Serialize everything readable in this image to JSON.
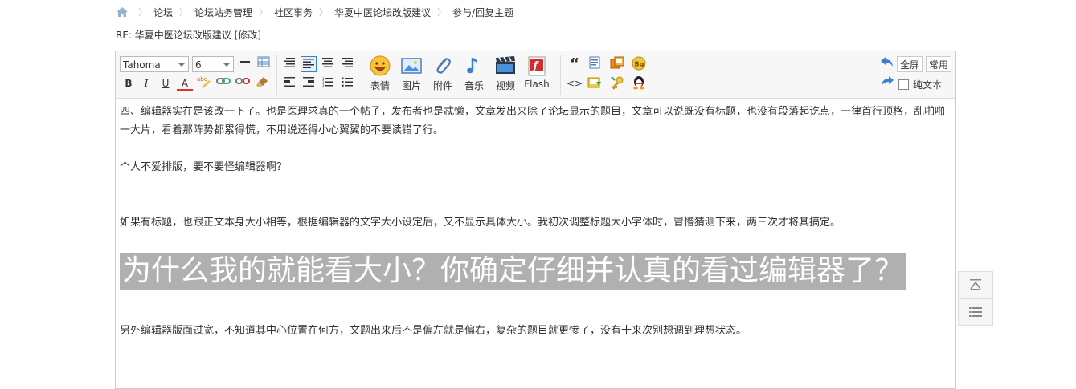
{
  "breadcrumb": {
    "items": [
      "论坛",
      "论坛站务管理",
      "社区事务",
      "华夏中医论坛改版建议",
      "参与/回复主题"
    ]
  },
  "subtitle": "RE: 华夏中医论坛改版建议 [修改]",
  "toolbar": {
    "font_family": "Tahoma",
    "font_size": "6",
    "big_buttons": [
      "表情",
      "图片",
      "附件",
      "音乐",
      "视频",
      "Flash"
    ],
    "fullscreen": "全屏",
    "common": "常用",
    "plain_text": "纯文本",
    "bold": "B",
    "italic": "I",
    "underline": "U",
    "font_color": "A",
    "quote": "“",
    "code": "<>"
  },
  "content": {
    "p1": "四、编辑器实在是该改一下了。也是医理求真的一个帖子，发布者也是忒懒，文章发出来除了论坛显示的题目，文章可以说既没有标题，也没有段落起讫点，一律首行顶格，乱啪啪一大片，看着那阵势都累得慌，不用说还得小心翼翼的不要读错了行。",
    "p2": "个人不爱排版，要不要怪编辑器啊？",
    "p3": "如果有标题，也跟正文本身大小相等，根据编辑器的文字大小设定后，又不显示具体大小。我初次调整标题大小字体时，冒懵猜测下来，两三次才将其搞定。",
    "heading": "为什么我的就能看大小？你确定仔细并认真的看过编辑器了？",
    "p4": "另外编辑器版面过宽，不知道其中心位置在何方，文题出来后不是偏左就是偏右，复杂的题目就更惨了，没有十来次别想调到理想状态。"
  },
  "colors": {
    "accent": "#3f7fc0",
    "heading_bg": "#b0b0b0"
  }
}
